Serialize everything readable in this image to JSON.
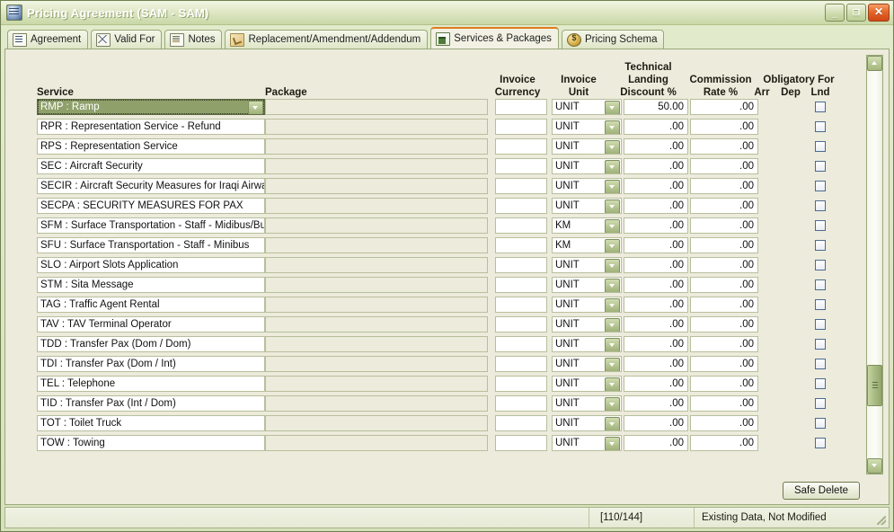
{
  "window": {
    "title": "Pricing Agreement (SAM - SAM)",
    "icon": "app-icon",
    "minimize_label": "_",
    "maximize_label": "❐",
    "close_label": "✕"
  },
  "tabs": [
    {
      "label": "Agreement",
      "icon": "agreement-icon",
      "active": false
    },
    {
      "label": "Valid For",
      "icon": "calendar-icon",
      "active": false
    },
    {
      "label": "Notes",
      "icon": "notes-icon",
      "active": false
    },
    {
      "label": "Replacement/Amendment/Addendum",
      "icon": "arrow-icon",
      "active": false
    },
    {
      "label": "Services & Packages",
      "icon": "services-icon",
      "active": true
    },
    {
      "label": "Pricing Schema",
      "icon": "money-bag-icon",
      "active": false
    }
  ],
  "grid": {
    "headers": {
      "service": "Service",
      "package": "Package",
      "invoice_currency": "Invoice\nCurrency",
      "invoice_currency_l1": "Invoice",
      "invoice_currency_l2": "Currency",
      "invoice_unit_l1": "Invoice",
      "invoice_unit_l2": "Unit",
      "technical_landing_l1": "Technical",
      "technical_landing_l2": "Landing",
      "technical_landing_l3": "Discount %",
      "commission_l1": "Commission",
      "commission_l2": "Rate %",
      "obligatory_for": "Obligatory For",
      "obligatory_arr": "Arr",
      "obligatory_dep": "Dep",
      "obligatory_lnd": "Lnd"
    },
    "rows": [
      {
        "service": "RMP : Ramp",
        "package": "",
        "invoice_currency": "",
        "invoice_unit": "UNIT",
        "technical_landing_discount": "50.00",
        "commission_rate": ".00",
        "obligatory_lnd": false,
        "selected": true
      },
      {
        "service": "RPR : Representation Service - Refund",
        "package": "",
        "invoice_currency": "",
        "invoice_unit": "UNIT",
        "technical_landing_discount": ".00",
        "commission_rate": ".00",
        "obligatory_lnd": false,
        "selected": false
      },
      {
        "service": "RPS : Representation Service",
        "package": "",
        "invoice_currency": "",
        "invoice_unit": "UNIT",
        "technical_landing_discount": ".00",
        "commission_rate": ".00",
        "obligatory_lnd": false,
        "selected": false
      },
      {
        "service": "SEC : Aircraft Security",
        "package": "",
        "invoice_currency": "",
        "invoice_unit": "UNIT",
        "technical_landing_discount": ".00",
        "commission_rate": ".00",
        "obligatory_lnd": false,
        "selected": false
      },
      {
        "service": "SECIR : Aircraft Security Measures for Iraqi Airways",
        "package": "",
        "invoice_currency": "",
        "invoice_unit": "UNIT",
        "technical_landing_discount": ".00",
        "commission_rate": ".00",
        "obligatory_lnd": false,
        "selected": false
      },
      {
        "service": "SECPA : SECURITY MEASURES FOR PAX",
        "package": "",
        "invoice_currency": "",
        "invoice_unit": "UNIT",
        "technical_landing_discount": ".00",
        "commission_rate": ".00",
        "obligatory_lnd": false,
        "selected": false
      },
      {
        "service": "SFM : Surface Transportation - Staff - Midibus/Bus",
        "package": "",
        "invoice_currency": "",
        "invoice_unit": "KM",
        "technical_landing_discount": ".00",
        "commission_rate": ".00",
        "obligatory_lnd": false,
        "selected": false
      },
      {
        "service": "SFU : Surface Transportation - Staff - Minibus",
        "package": "",
        "invoice_currency": "",
        "invoice_unit": "KM",
        "technical_landing_discount": ".00",
        "commission_rate": ".00",
        "obligatory_lnd": false,
        "selected": false
      },
      {
        "service": "SLO : Airport Slots Application",
        "package": "",
        "invoice_currency": "",
        "invoice_unit": "UNIT",
        "technical_landing_discount": ".00",
        "commission_rate": ".00",
        "obligatory_lnd": false,
        "selected": false
      },
      {
        "service": "STM : Sita Message",
        "package": "",
        "invoice_currency": "",
        "invoice_unit": "UNIT",
        "technical_landing_discount": ".00",
        "commission_rate": ".00",
        "obligatory_lnd": false,
        "selected": false
      },
      {
        "service": "TAG : Traffic Agent Rental",
        "package": "",
        "invoice_currency": "",
        "invoice_unit": "UNIT",
        "technical_landing_discount": ".00",
        "commission_rate": ".00",
        "obligatory_lnd": false,
        "selected": false
      },
      {
        "service": "TAV : TAV Terminal Operator",
        "package": "",
        "invoice_currency": "",
        "invoice_unit": "UNIT",
        "technical_landing_discount": ".00",
        "commission_rate": ".00",
        "obligatory_lnd": false,
        "selected": false
      },
      {
        "service": "TDD : Transfer Pax (Dom / Dom)",
        "package": "",
        "invoice_currency": "",
        "invoice_unit": "UNIT",
        "technical_landing_discount": ".00",
        "commission_rate": ".00",
        "obligatory_lnd": false,
        "selected": false
      },
      {
        "service": "TDI : Transfer Pax (Dom / Int)",
        "package": "",
        "invoice_currency": "",
        "invoice_unit": "UNIT",
        "technical_landing_discount": ".00",
        "commission_rate": ".00",
        "obligatory_lnd": false,
        "selected": false
      },
      {
        "service": "TEL : Telephone",
        "package": "",
        "invoice_currency": "",
        "invoice_unit": "UNIT",
        "technical_landing_discount": ".00",
        "commission_rate": ".00",
        "obligatory_lnd": false,
        "selected": false
      },
      {
        "service": "TID : Transfer Pax (Int / Dom)",
        "package": "",
        "invoice_currency": "",
        "invoice_unit": "UNIT",
        "technical_landing_discount": ".00",
        "commission_rate": ".00",
        "obligatory_lnd": false,
        "selected": false
      },
      {
        "service": "TOT : Toilet Truck",
        "package": "",
        "invoice_currency": "",
        "invoice_unit": "UNIT",
        "technical_landing_discount": ".00",
        "commission_rate": ".00",
        "obligatory_lnd": false,
        "selected": false
      },
      {
        "service": "TOW : Towing",
        "package": "",
        "invoice_currency": "",
        "invoice_unit": "UNIT",
        "technical_landing_discount": ".00",
        "commission_rate": ".00",
        "obligatory_lnd": false,
        "selected": false
      }
    ]
  },
  "actions": {
    "safe_delete": "Safe Delete"
  },
  "statusbar": {
    "record_counter": "[110/144]",
    "message": "Existing Data, Not Modified"
  },
  "colors": {
    "frame": "#6f7f52",
    "titlebar": "#dfe8c6",
    "client": "#edebdc",
    "selection": "#8fa06a",
    "active_tab_accent": "#e07b1e",
    "close_button": "#e4672a"
  }
}
